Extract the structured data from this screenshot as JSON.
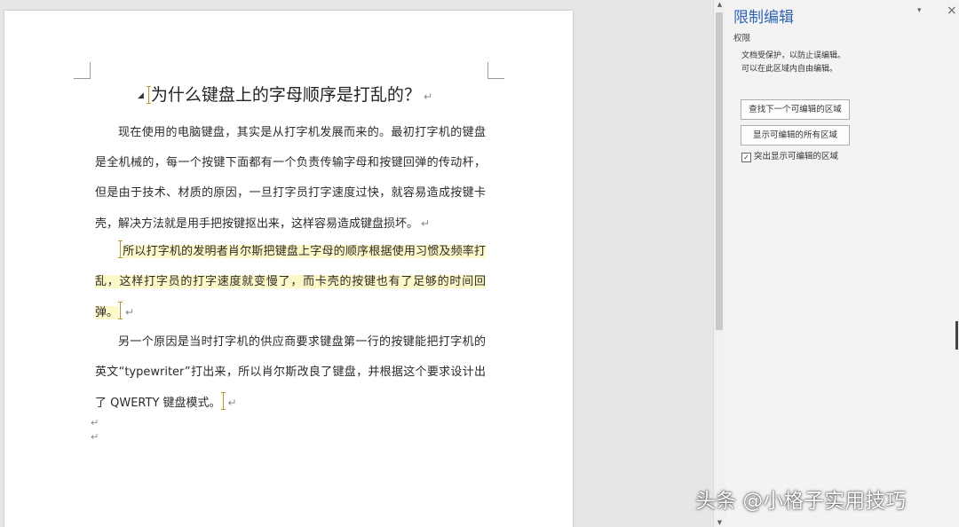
{
  "document": {
    "title": "为什么键盘上的字母顺序是打乱的？",
    "paragraph1": "现在使用的电脑键盘，其实是从打字机发展而来的。最初打字机的键盘是全机械的，每一个按键下面都有一个负责传输字母和按键回弹的传动杆，但是由于技术、材质的原因，一旦打字员打字速度过快，就容易造成按键卡壳，解决方法就是用手把按键抠出来，这样容易造成键盘损坏。",
    "paragraph2": "所以打字机的发明者肖尔斯把键盘上字母的顺序根据使用习惯及频率打乱，这样打字员的打字速度就变慢了，而卡壳的按键也有了足够的时间回弹。",
    "paragraph3": "另一个原因是当时打字机的供应商要求键盘第一行的按键能把打字机的英文“typewriter”打出来，所以肖尔斯改良了键盘，并根据这个要求设计出了 QWERTY 键盘模式。",
    "paragraph_mark": "↵"
  },
  "panel": {
    "title": "限制编辑",
    "menu_icon": "▾",
    "close_icon": "×",
    "section_label": "权限",
    "description_line1": "文档受保护，以防止误编辑。",
    "description_line2": "可以在此区域内自由编辑。",
    "find_next_button": "查找下一个可编辑的区域",
    "show_all_button": "显示可编辑的所有区域",
    "highlight_checkbox_label": "突出显示可编辑的区域",
    "highlight_checked": true,
    "check_glyph": "✓"
  },
  "watermark": {
    "text": "头条 @小格子实用技巧"
  },
  "colors": {
    "panel_title": "#2f64b4",
    "editable_highlight": "#fdf8c8",
    "region_bracket": "#b8962c"
  }
}
